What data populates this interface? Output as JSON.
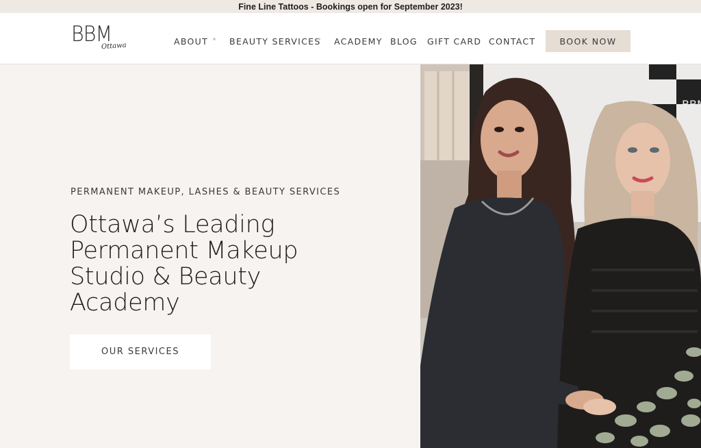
{
  "announcement": "Fine Line Tattoos - Bookings open for September 2023!",
  "logo": {
    "mark": "BBM",
    "sub": "Ottawa"
  },
  "nav": {
    "items": [
      {
        "label": "ABOUT",
        "has_dropdown": true
      },
      {
        "label": "BEAUTY SERVICES",
        "has_dropdown": true
      },
      {
        "label": "ACADEMY",
        "has_dropdown": false
      },
      {
        "label": "BLOG",
        "has_dropdown": false
      },
      {
        "label": "GIFT CARD",
        "has_dropdown": false
      },
      {
        "label": "CONTACT",
        "has_dropdown": false
      }
    ],
    "cta": "BOOK NOW"
  },
  "hero": {
    "eyebrow": "PERMANENT MAKEUP, LASHES & BEAUTY SERVICES",
    "headline": "Ottawa’s Leading Permanent Makeup Studio & Beauty Academy",
    "button": "OUR SERVICES",
    "image_sign_text": "BBM"
  },
  "colors": {
    "page_bg": "#f7f3f0",
    "announce_bg": "#efe9e4",
    "cta_bg": "#e6ddd5",
    "text": "#2a2a2a"
  }
}
